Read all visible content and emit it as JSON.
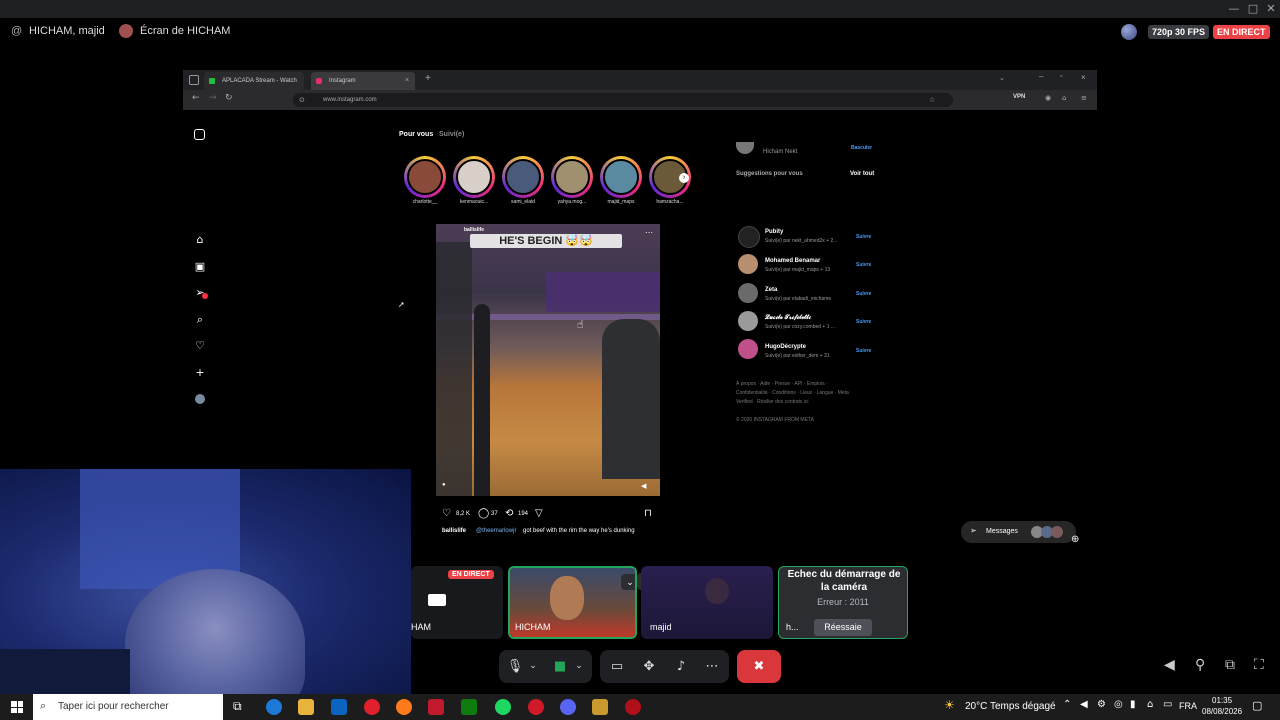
{
  "call": {
    "channel": "HICHAM, majid",
    "screen_title": "Écran de HICHAM",
    "quality": "720p 30 FPS",
    "live_badge": "EN DIRECT"
  },
  "browser": {
    "tabs": [
      {
        "label": "APLACADA Stream - Watch"
      },
      {
        "label": "Instagram"
      }
    ],
    "url": "www.instagram.com",
    "vpn_label": "VPN"
  },
  "instagram": {
    "feed_tabs": {
      "for_you": "Pour vous",
      "following": "Suivi(e)"
    },
    "stories": [
      "charlotte__",
      "kenmaouic...",
      "sami_elaid",
      "yahya.mog...",
      "majid_maps",
      "hamzacha..."
    ],
    "post": {
      "user": "ballislife",
      "overlay_text": "HE'S BEGIN 🤯🤯",
      "likes": "8,2 K",
      "comments": "37",
      "reposts": "194",
      "caption_user": "ballislife",
      "caption_mention": "@theemarlowjr",
      "caption_text": "got beef with the rim the way he's dunking"
    },
    "current_user": {
      "name": "Hicham Nekt",
      "switch": "Basculer"
    },
    "suggestions_title": "Suggestions pour vous",
    "see_all": "Voir tout",
    "suggestions": [
      {
        "name": "Pubity",
        "sub": "Suivi(e) par nekt_ahmed2x + 2...",
        "follow": "Suivre"
      },
      {
        "name": "Mohamed Benamar",
        "sub": "Suivi(e) par majid_maps + 13",
        "follow": "Suivre"
      },
      {
        "name": "Zeta",
        "sub": "Suivi(e) par elabadi_michame",
        "follow": "Suivre"
      },
      {
        "name": "𝓛𝓾𝓬𝓲𝓵𝓮 𝓣𝓻𝓲𝓯𝓲𝓵𝓮𝓽𝓽𝓲",
        "sub": "Suivi(e) par cozy.combed + 1 ...",
        "follow": "Suivre"
      },
      {
        "name": "HugoDécrypte",
        "sub": "Suivi(e) par esther_dem + 31",
        "follow": "Suivre"
      }
    ],
    "footer_links": "À propos · Aide · Presse · API · Emplois · Confidentialité · Conditions · Lieux · Langue · Meta Verified · Résilier des contrats ici",
    "copyright": "© 2026 INSTAGRAM FROM META",
    "messages_label": "Messages"
  },
  "tiles": {
    "tile1_name": "HAM",
    "tile1_live": "EN DIRECT",
    "tile2_name": "HICHAM",
    "tile3_name": "majid",
    "error_title": "Echec du démarrage de la caméra",
    "error_code": "Erreur : 2011",
    "retry": "Réessaie",
    "error_short": "h..."
  },
  "taskbar": {
    "search_placeholder": "Taper ici pour rechercher",
    "weather_temp": "20°C",
    "weather_desc": "Temps dégagé",
    "language": "FRA",
    "time": "01:35",
    "date": "08/08/2026"
  },
  "colors": {
    "live_red": "#ed4245",
    "discord_bg": "#1f2024",
    "end_call": "#da373c",
    "follow_blue": "#4a9cf5"
  }
}
